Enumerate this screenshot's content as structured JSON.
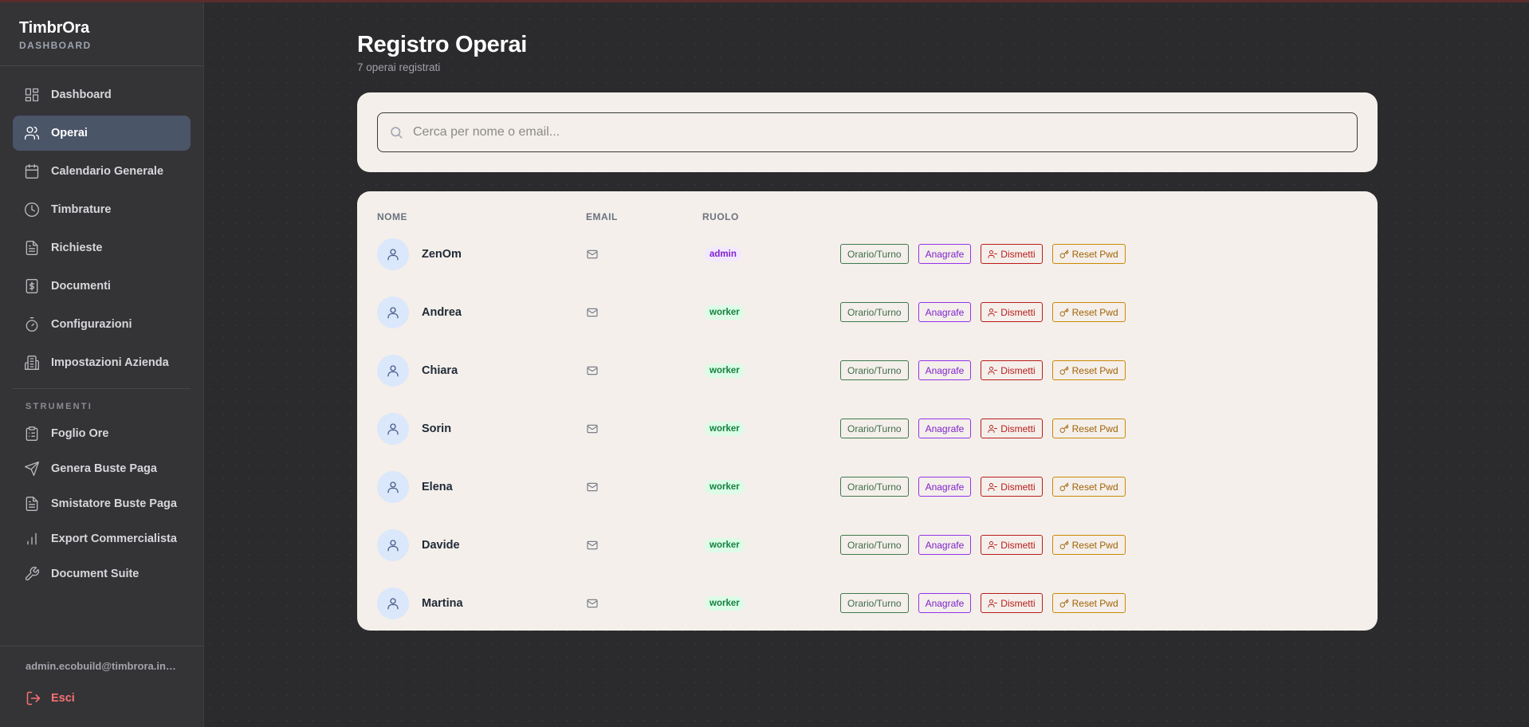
{
  "app": {
    "title": "TimbrOra",
    "subtitle": "DASHBOARD"
  },
  "sidebar": {
    "items": [
      {
        "label": "Dashboard",
        "icon": "dashboard-grid-icon"
      },
      {
        "label": "Operai",
        "icon": "users-icon",
        "active": true
      },
      {
        "label": "Calendario Generale",
        "icon": "calendar-icon"
      },
      {
        "label": "Timbrature",
        "icon": "clock-icon"
      },
      {
        "label": "Richieste",
        "icon": "document-icon"
      },
      {
        "label": "Documenti",
        "icon": "dollar-document-icon"
      },
      {
        "label": "Configurazioni",
        "icon": "timer-icon"
      },
      {
        "label": "Impostazioni Azienda",
        "icon": "building-icon"
      }
    ],
    "section_label": "STRUMENTI",
    "tools": [
      {
        "label": "Foglio Ore",
        "icon": "clipboard-icon"
      },
      {
        "label": "Genera Buste Paga",
        "icon": "send-icon"
      },
      {
        "label": "Smistatore Buste Paga",
        "icon": "document-icon"
      },
      {
        "label": "Export Commercialista",
        "icon": "bar-chart-icon"
      },
      {
        "label": "Document Suite",
        "icon": "wrench-icon"
      }
    ],
    "user_email": "admin.ecobuild@timbrora.inter...",
    "logout_label": "Esci"
  },
  "page": {
    "title": "Registro Operai",
    "subtitle": "7 operai registrati"
  },
  "search": {
    "placeholder": "Cerca per nome o email..."
  },
  "table": {
    "columns": [
      "NOME",
      "EMAIL",
      "RUOLO"
    ],
    "actions": {
      "orario": "Orario/Turno",
      "anagrafe": "Anagrafe",
      "dismetti": "Dismetti",
      "reset": "Reset Pwd"
    },
    "rows": [
      {
        "name": "ZenOm",
        "role": "admin"
      },
      {
        "name": "Andrea",
        "role": "worker"
      },
      {
        "name": "Chiara",
        "role": "worker"
      },
      {
        "name": "Sorin",
        "role": "worker"
      },
      {
        "name": "Elena",
        "role": "worker"
      },
      {
        "name": "Davide",
        "role": "worker"
      },
      {
        "name": "Martina",
        "role": "worker"
      }
    ]
  },
  "colors": {
    "background": "#2b2b2d",
    "sidebar": "#343437",
    "active_item": "#4b5568",
    "card": "#f4efea",
    "logout": "#f87171"
  }
}
